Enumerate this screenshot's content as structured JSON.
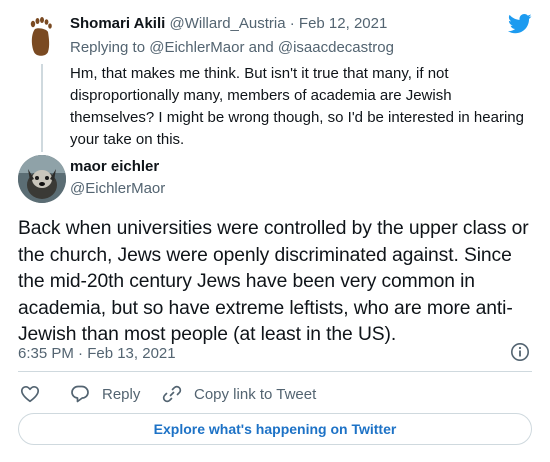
{
  "parent_tweet": {
    "name": "Shomari Akili",
    "handle": "@Willard_Austria",
    "separator": "·",
    "date": "Feb 12, 2021",
    "replying_prefix": "Replying to",
    "reply_to_1": "@EichlerMaor",
    "reply_and": "and",
    "reply_to_2": "@isaacdecastrog",
    "text": "Hm, that makes me think. But isn't it true that many, if not disproportionally many, members of academia are Jewish themselves? I might be wrong though, so I'd be interested in hearing your take on this."
  },
  "main_tweet": {
    "name": "maor eichler",
    "handle": "@EichlerMaor",
    "text": "Back when universities were controlled by the upper class or the church, Jews were openly discriminated against. Since the mid-20th century Jews have been very common in academia, but so have extreme leftists, who are more anti-Jewish than most people (at least in the US).",
    "timestamp": "6:35 PM · Feb 13, 2021"
  },
  "actions": {
    "reply_label": "Reply",
    "copy_label": "Copy link to Tweet"
  },
  "explore_label": "Explore what's happening on Twitter",
  "icons": {
    "brand": "twitter-bird-icon",
    "like": "heart-icon",
    "reply": "reply-bubble-icon",
    "copy": "link-icon",
    "info": "info-icon"
  },
  "colors": {
    "text": "#0f1419",
    "muted": "#536471",
    "brand": "#1d9bf0",
    "link": "#1d72c6",
    "border": "#cfd9de"
  }
}
